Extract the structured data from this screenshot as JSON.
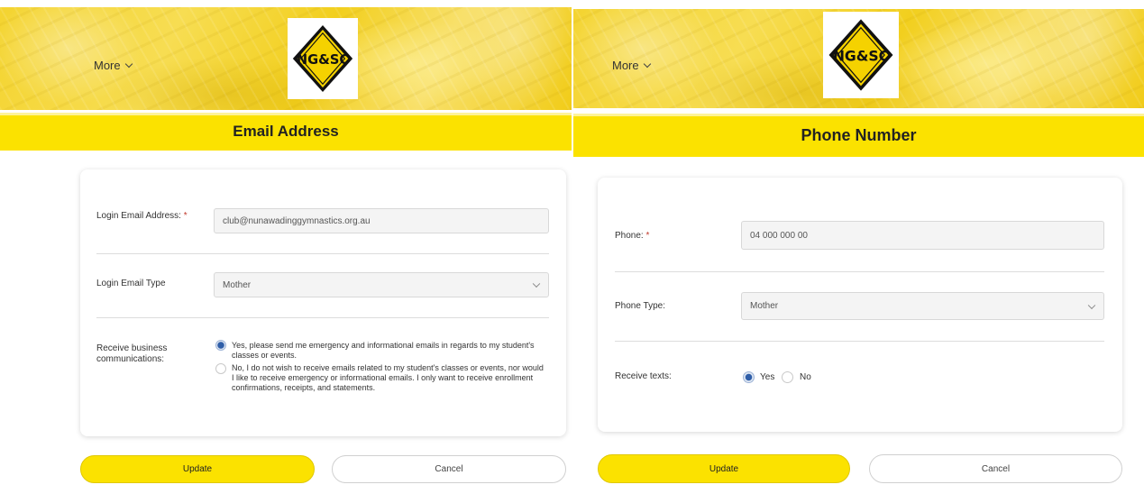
{
  "left": {
    "nav": {
      "more_label": "More"
    },
    "logo": {
      "text": "NG&SC"
    },
    "title": "Email Address",
    "form": {
      "email": {
        "label": "Login Email Address:",
        "required_mark": "*",
        "value": "club@nunawadinggymnastics.org.au"
      },
      "email_type": {
        "label": "Login Email Type",
        "selected": "Mother"
      },
      "communications": {
        "label": "Receive business communications:",
        "options": [
          {
            "text": "Yes, please send me emergency and informational emails in regards to my student's classes or events.",
            "selected": true
          },
          {
            "text": "No, I do not wish to receive emails related to my student's classes or events, nor would I like to receive emergency or informational emails. I only want to receive enrollment confirmations, receipts, and statements.",
            "selected": false
          }
        ]
      }
    },
    "buttons": {
      "update": "Update",
      "cancel": "Cancel"
    }
  },
  "right": {
    "nav": {
      "more_label": "More"
    },
    "logo": {
      "text": "NG&SC"
    },
    "title": "Phone Number",
    "form": {
      "phone": {
        "label": "Phone:",
        "required_mark": "*",
        "value": "04 000 000 00"
      },
      "phone_type": {
        "label": "Phone Type:",
        "selected": "Mother"
      },
      "texts": {
        "label": "Receive texts:",
        "yes": "Yes",
        "no": "No",
        "selected": "Yes"
      }
    },
    "buttons": {
      "update": "Update",
      "cancel": "Cancel"
    }
  },
  "colors": {
    "accent_yellow": "#fbe200",
    "radio_selected": "#2f5ea8",
    "required": "#c0392b"
  }
}
